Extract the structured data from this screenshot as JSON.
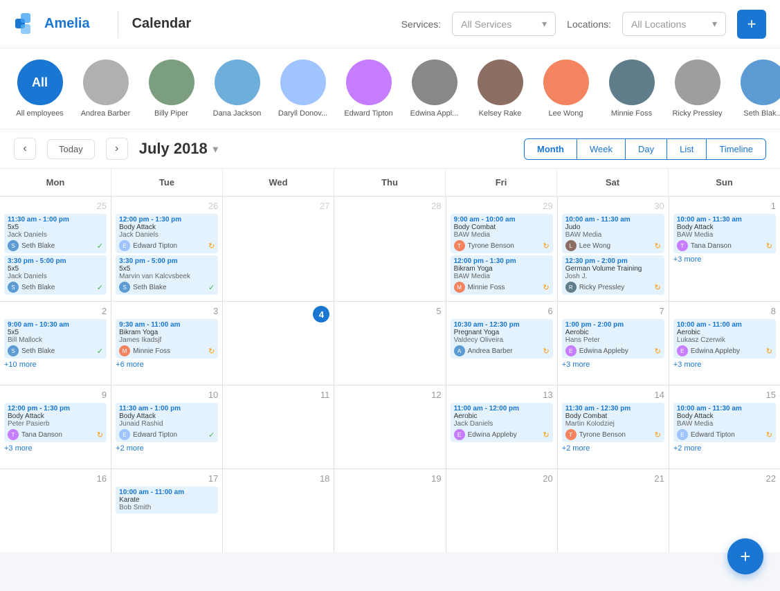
{
  "header": {
    "brand": "Amelia",
    "page_title": "Calendar",
    "services_label": "Services:",
    "services_placeholder": "All Services",
    "locations_label": "Locations:",
    "locations_placeholder": "All Locations",
    "add_button": "+"
  },
  "employees": [
    {
      "id": "all",
      "label": "All employees",
      "initials": "All",
      "is_all": true,
      "selected": true
    },
    {
      "id": "andrea",
      "label": "Andrea Barber",
      "color": "#5c9bd4"
    },
    {
      "id": "billy",
      "label": "Billy Piper",
      "color": "#888"
    },
    {
      "id": "dana",
      "label": "Dana Jackson",
      "color": "#7a9e7e"
    },
    {
      "id": "daryll",
      "label": "Daryll Donov...",
      "color": "#6daedb"
    },
    {
      "id": "edward",
      "label": "Edward Tipton",
      "color": "#a0c4ff"
    },
    {
      "id": "edwina",
      "label": "Edwina Appl...",
      "color": "#c77dff"
    },
    {
      "id": "kelsey",
      "label": "Kelsey Rake",
      "color": "#888"
    },
    {
      "id": "lee",
      "label": "Lee Wong",
      "color": "#888"
    },
    {
      "id": "minnie",
      "label": "Minnie Foss",
      "color": "#f4845f"
    },
    {
      "id": "ricky",
      "label": "Ricky Pressley",
      "color": "#888"
    },
    {
      "id": "seth",
      "label": "Seth Blak...",
      "color": "#888"
    }
  ],
  "calendar": {
    "month_year": "July 2018",
    "view_buttons": [
      "Month",
      "Week",
      "Day",
      "List",
      "Timeline"
    ],
    "active_view": "Month",
    "today_label": "Today",
    "days": [
      "Mon",
      "Tue",
      "Wed",
      "Thu",
      "Fri",
      "Sat",
      "Sun"
    ],
    "rows": [
      {
        "cells": [
          {
            "date": "25",
            "other": true,
            "events": [
              {
                "time": "11:30 am - 1:00 pm",
                "name": "5x5",
                "location": "Jack Daniels",
                "person": "Seth Blake",
                "status": "check"
              },
              {
                "time": "3:30 pm - 5:00 pm",
                "name": "5x5",
                "location": "Jack Daniels",
                "person": "Seth Blake",
                "status": "check"
              }
            ]
          },
          {
            "date": "26",
            "other": true,
            "events": [
              {
                "time": "12:00 pm - 1:30 pm",
                "name": "Body Attack",
                "location": "Jack Daniels",
                "person": "Edward Tipton",
                "status": "pending"
              },
              {
                "time": "3:30 pm - 5:00 pm",
                "name": "5x5",
                "location": "Marvin van Kalcvsbeek",
                "person": "Seth Blake",
                "status": "check"
              }
            ]
          },
          {
            "date": "27",
            "other": true,
            "events": []
          },
          {
            "date": "28",
            "other": true,
            "events": []
          },
          {
            "date": "29",
            "other": true,
            "events": [
              {
                "time": "9:00 am - 10:00 am",
                "name": "Body Combat",
                "location": "BAW Media",
                "person": "Tyrone Benson",
                "status": "pending"
              },
              {
                "time": "12:00 pm - 1:30 pm",
                "name": "Bikram Yoga",
                "location": "BAW Media",
                "person": "Minnie Foss",
                "status": "pending"
              }
            ]
          },
          {
            "date": "30",
            "other": true,
            "events": [
              {
                "time": "10:00 am - 11:30 am",
                "name": "Judo",
                "location": "BAW Media",
                "person": "Lee Wong",
                "status": "pending"
              },
              {
                "time": "12:30 pm - 2:00 pm",
                "name": "German Volume Training",
                "location": "Josh J.",
                "person": "Ricky Pressley",
                "status": "pending"
              }
            ]
          },
          {
            "date": "1",
            "events": [
              {
                "time": "10:00 am - 11:30 am",
                "name": "Body Attack",
                "location": "BAW Media",
                "person": "Tana Danson",
                "status": "pending"
              }
            ],
            "more": "+3 more"
          }
        ]
      },
      {
        "cells": [
          {
            "date": "2",
            "events": [
              {
                "time": "9:00 am - 10:30 am",
                "name": "5x5",
                "location": "Bill Mallock",
                "person": "Seth Blake",
                "status": "check"
              }
            ],
            "more": "+10 more"
          },
          {
            "date": "3",
            "events": [
              {
                "time": "9:30 am - 11:00 am",
                "name": "Bikram Yoga",
                "location": "James Ikadsjf",
                "person": "Minnie Foss",
                "status": "pending"
              }
            ],
            "more": "+6 more"
          },
          {
            "date": "4",
            "today": true,
            "events": []
          },
          {
            "date": "5",
            "events": []
          },
          {
            "date": "6",
            "events": [
              {
                "time": "10:30 am - 12:30 pm",
                "name": "Pregnant Yoga",
                "location": "Valdecy Oliveira",
                "person": "Andrea Barber",
                "status": "pending"
              }
            ]
          },
          {
            "date": "7",
            "events": [
              {
                "time": "1:00 pm - 2:00 pm",
                "name": "Aerobic",
                "location": "Hans Peter",
                "person": "Edwina Appleby",
                "status": "pending"
              }
            ],
            "more": "+3 more"
          },
          {
            "date": "8",
            "events": [
              {
                "time": "10:00 am - 11:00 am",
                "name": "Aerobic",
                "location": "Lukasz Czerwik",
                "person": "Edwina Appleby",
                "status": "pending"
              }
            ],
            "more": "+3 more"
          }
        ]
      },
      {
        "cells": [
          {
            "date": "9",
            "events": [
              {
                "time": "12:00 pm - 1:30 pm",
                "name": "Body Attack",
                "location": "Peter Pasierb",
                "person": "Tana Danson",
                "status": "pending"
              }
            ],
            "more": "+3 more"
          },
          {
            "date": "10",
            "events": [
              {
                "time": "11:30 am - 1:00 pm",
                "name": "Body Attack",
                "location": "Junaid Rashid",
                "person": "Edward Tipton",
                "status": "check"
              }
            ],
            "more": "+2 more"
          },
          {
            "date": "11",
            "events": []
          },
          {
            "date": "12",
            "events": []
          },
          {
            "date": "13",
            "events": [
              {
                "time": "11:00 am - 12:00 pm",
                "name": "Aerobic",
                "location": "Jack Daniels",
                "person": "Edwina Appleby",
                "status": "pending"
              }
            ]
          },
          {
            "date": "14",
            "events": [
              {
                "time": "11:30 am - 12:30 pm",
                "name": "Body Combat",
                "location": "Martin Kolodziej",
                "person": "Tyrone Benson",
                "status": "pending"
              }
            ],
            "more": "+2 more"
          },
          {
            "date": "15",
            "events": [
              {
                "time": "10:00 am - 11:30 am",
                "name": "Body Attack",
                "location": "BAW Media",
                "person": "Edward Tipton",
                "status": "pending"
              }
            ],
            "more": "+2 more"
          }
        ]
      },
      {
        "cells": [
          {
            "date": "16",
            "events": []
          },
          {
            "date": "17",
            "events": [
              {
                "time": "10:00 am - 11:00 am",
                "name": "Karate",
                "location": "Bob Smith",
                "person": null
              }
            ]
          },
          {
            "date": "18",
            "events": []
          },
          {
            "date": "19",
            "events": []
          },
          {
            "date": "20",
            "events": []
          },
          {
            "date": "21",
            "events": []
          },
          {
            "date": "22",
            "events": []
          }
        ]
      }
    ]
  },
  "fab_label": "+"
}
